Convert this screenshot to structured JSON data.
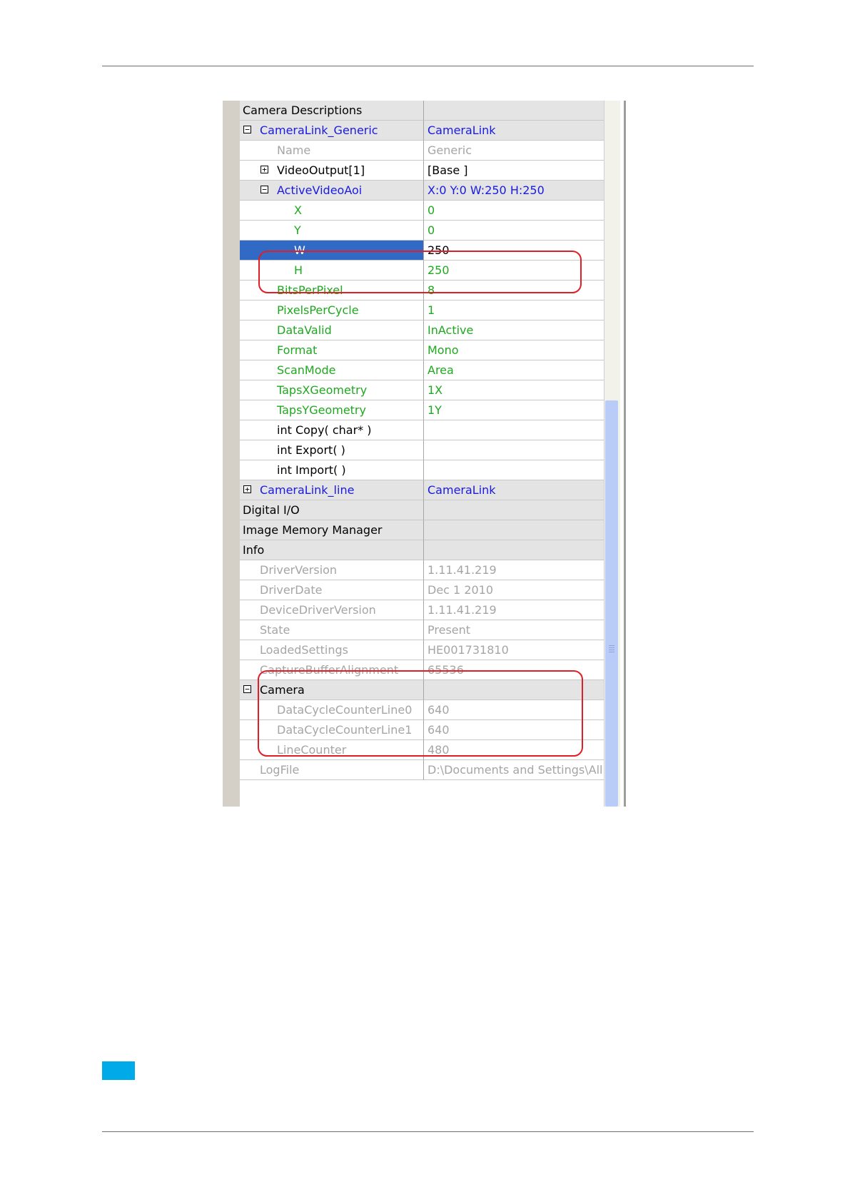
{
  "property_grid": {
    "rows": [
      {
        "name": "Camera Descriptions",
        "value": "",
        "toggle": "−",
        "level": 0,
        "category": true,
        "name_color": "black",
        "value_color": "black"
      },
      {
        "name": "CameraLink_Generic",
        "value": "CameraLink",
        "toggle": "−",
        "level": 1,
        "category": true,
        "name_color": "blue",
        "value_color": "blue"
      },
      {
        "name": "Name",
        "value": "Generic",
        "toggle": "",
        "level": 2,
        "category": false,
        "name_color": "gray",
        "value_color": "gray"
      },
      {
        "name": "VideoOutput[1]",
        "value": "[Base ]",
        "toggle": "+",
        "level": 2,
        "category": false,
        "name_color": "black",
        "value_color": "black"
      },
      {
        "name": "ActiveVideoAoi",
        "value": "X:0 Y:0 W:250 H:250",
        "toggle": "−",
        "level": 2,
        "category": true,
        "name_color": "blue",
        "value_color": "blue"
      },
      {
        "name": "X",
        "value": "0",
        "toggle": "",
        "level": 3,
        "category": false,
        "name_color": "green",
        "value_color": "green"
      },
      {
        "name": "Y",
        "value": "0",
        "toggle": "",
        "level": 3,
        "category": false,
        "name_color": "green",
        "value_color": "green"
      },
      {
        "name": "W",
        "value": "250",
        "toggle": "",
        "level": 3,
        "category": false,
        "selected": true,
        "name_color": "white",
        "value_color": "black"
      },
      {
        "name": "H",
        "value": "250",
        "toggle": "",
        "level": 3,
        "category": false,
        "name_color": "green",
        "value_color": "green"
      },
      {
        "name": "BitsPerPixel",
        "value": "8",
        "toggle": "",
        "level": 2,
        "category": false,
        "name_color": "green",
        "value_color": "green"
      },
      {
        "name": "PixelsPerCycle",
        "value": "1",
        "toggle": "",
        "level": 2,
        "category": false,
        "name_color": "green",
        "value_color": "green"
      },
      {
        "name": "DataValid",
        "value": "InActive",
        "toggle": "",
        "level": 2,
        "category": false,
        "name_color": "green",
        "value_color": "green"
      },
      {
        "name": "Format",
        "value": "Mono",
        "toggle": "",
        "level": 2,
        "category": false,
        "name_color": "green",
        "value_color": "green"
      },
      {
        "name": "ScanMode",
        "value": "Area",
        "toggle": "",
        "level": 2,
        "category": false,
        "name_color": "green",
        "value_color": "green"
      },
      {
        "name": "TapsXGeometry",
        "value": "1X",
        "toggle": "",
        "level": 2,
        "category": false,
        "name_color": "green",
        "value_color": "green"
      },
      {
        "name": "TapsYGeometry",
        "value": "1Y",
        "toggle": "",
        "level": 2,
        "category": false,
        "name_color": "green",
        "value_color": "green"
      },
      {
        "name": "int Copy( char* )",
        "value": "",
        "toggle": "",
        "level": 2,
        "category": false,
        "name_color": "black",
        "value_color": "black"
      },
      {
        "name": "int Export( )",
        "value": "",
        "toggle": "",
        "level": 2,
        "category": false,
        "name_color": "black",
        "value_color": "black"
      },
      {
        "name": "int Import( )",
        "value": "",
        "toggle": "",
        "level": 2,
        "category": false,
        "name_color": "black",
        "value_color": "black"
      },
      {
        "name": "CameraLink_line",
        "value": "CameraLink",
        "toggle": "+",
        "level": 1,
        "category": true,
        "name_color": "blue",
        "value_color": "blue"
      },
      {
        "name": "Digital I/O",
        "value": "",
        "toggle": "+",
        "level": 0,
        "category": true,
        "name_color": "black",
        "value_color": "black"
      },
      {
        "name": "Image Memory Manager",
        "value": "",
        "toggle": "+",
        "level": 0,
        "category": true,
        "name_color": "black",
        "value_color": "black"
      },
      {
        "name": "Info",
        "value": "",
        "toggle": "−",
        "level": 0,
        "category": true,
        "name_color": "black",
        "value_color": "black"
      },
      {
        "name": "DriverVersion",
        "value": "1.11.41.219",
        "toggle": "",
        "level": 1,
        "category": false,
        "name_color": "gray",
        "value_color": "gray"
      },
      {
        "name": "DriverDate",
        "value": "Dec  1 2010",
        "toggle": "",
        "level": 1,
        "category": false,
        "name_color": "gray",
        "value_color": "gray"
      },
      {
        "name": "DeviceDriverVersion",
        "value": "1.11.41.219",
        "toggle": "",
        "level": 1,
        "category": false,
        "name_color": "gray",
        "value_color": "gray"
      },
      {
        "name": "State",
        "value": "Present",
        "toggle": "",
        "level": 1,
        "category": false,
        "name_color": "gray",
        "value_color": "gray"
      },
      {
        "name": "LoadedSettings",
        "value": "HE001731810",
        "toggle": "",
        "level": 1,
        "category": false,
        "name_color": "gray",
        "value_color": "gray"
      },
      {
        "name": "CaptureBufferAlignment",
        "value": "65536",
        "toggle": "",
        "level": 1,
        "category": false,
        "name_color": "gray",
        "value_color": "gray"
      },
      {
        "name": "Camera",
        "value": "",
        "toggle": "−",
        "level": 1,
        "category": true,
        "name_color": "black",
        "value_color": "black"
      },
      {
        "name": "DataCycleCounterLine0",
        "value": "640",
        "toggle": "",
        "level": 2,
        "category": false,
        "name_color": "gray",
        "value_color": "gray"
      },
      {
        "name": "DataCycleCounterLine1",
        "value": "640",
        "toggle": "",
        "level": 2,
        "category": false,
        "name_color": "gray",
        "value_color": "gray"
      },
      {
        "name": "LineCounter",
        "value": "480",
        "toggle": "",
        "level": 2,
        "category": false,
        "name_color": "gray",
        "value_color": "gray"
      },
      {
        "name": "LogFile",
        "value": "D:\\Documents and Settings\\All U",
        "toggle": "",
        "level": 1,
        "category": false,
        "name_color": "gray",
        "value_color": "gray"
      }
    ]
  },
  "colors": {
    "black": "#000000",
    "blue": "#1a1ae0",
    "green": "#1fa81f",
    "gray": "#a5a5a5",
    "white": "#ffffff",
    "selection": "#316ac5",
    "highlight_box": "#e01e26",
    "footer_tab": "#00a9e8"
  }
}
